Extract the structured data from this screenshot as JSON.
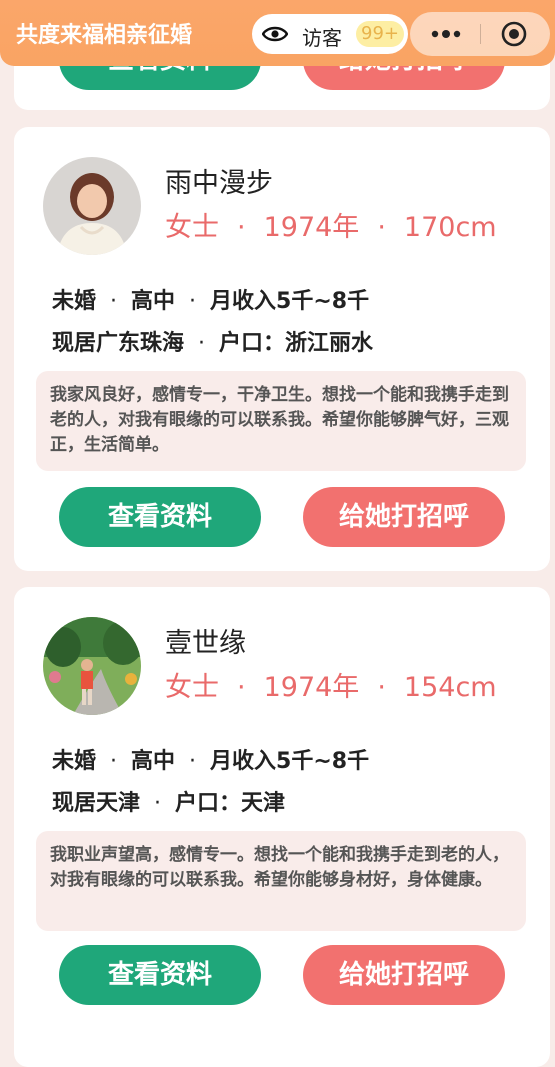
{
  "header": {
    "title": "共度来福相亲征婚",
    "visitor_label": "访客",
    "visitor_badge": "99+"
  },
  "card_top": {
    "view_button": "查看资料",
    "greet_button": "给她打招呼"
  },
  "profiles": [
    {
      "nickname": "雨中漫步",
      "gender": "女士",
      "birth_year": "1974年",
      "height": "170cm",
      "marital": "未婚",
      "education": "高中",
      "income": "月收入5千~8千",
      "residence": "现居广东珠海",
      "hukou": "户口：浙江丽水",
      "intro": "我家风良好，感情专一，干净卫生。想找一个能和我携手走到老的人，对我有眼缘的可以联系我。希望你能够脾气好，三观正，生活简单。",
      "view_button": "查看资料",
      "greet_button": "给她打招呼"
    },
    {
      "nickname": "壹世缘",
      "gender": "女士",
      "birth_year": "1974年",
      "height": "154cm",
      "marital": "未婚",
      "education": "高中",
      "income": "月收入5千~8千",
      "residence": "现居天津",
      "hukou": "户口：天津",
      "intro": "我职业声望高，感情专一。想找一个能和我携手走到老的人，对我有眼缘的可以联系我。希望你能够身材好，身体健康。",
      "view_button": "查看资料",
      "greet_button": "给她打招呼"
    }
  ],
  "separator_dot": "·",
  "colors": {
    "header": "#f9a463",
    "accent_red": "#e96a6a",
    "button_green": "#1fa77a",
    "button_red": "#f2716f",
    "page_bg": "#f8ece9"
  },
  "icons": {
    "visitor": "eye-icon",
    "menu": "more-dots-icon",
    "close": "target-close-icon"
  }
}
